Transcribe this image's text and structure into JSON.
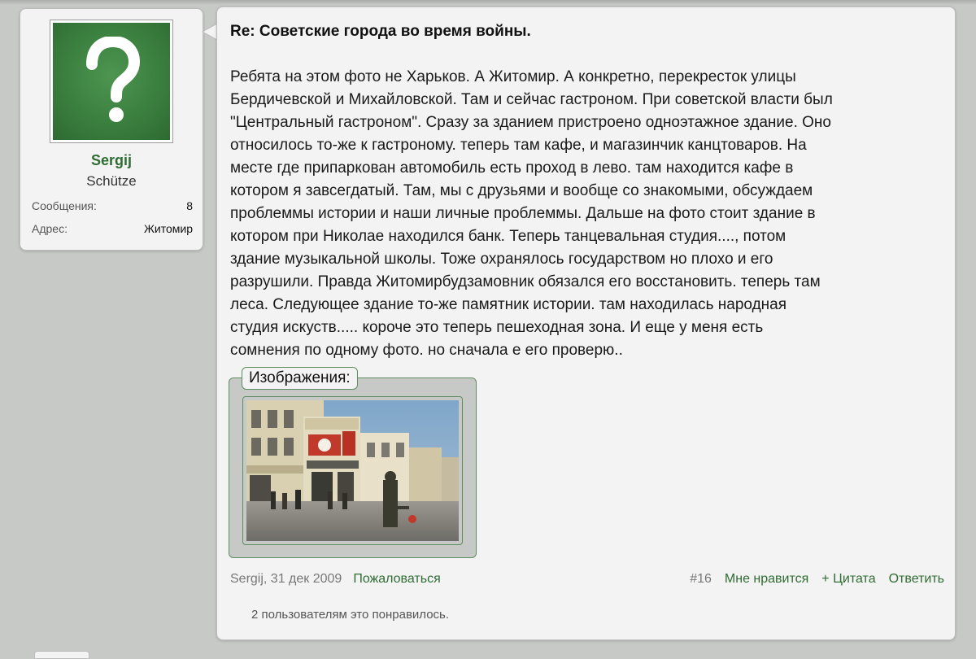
{
  "user": {
    "name": "Sergij",
    "title": "Schütze",
    "stats": [
      {
        "label": "Сообщения:",
        "value": "8"
      },
      {
        "label": "Адрес:",
        "value": "Житомир"
      }
    ],
    "avatar_icon": "question-mark-icon",
    "avatar_color": "#3b7f3f"
  },
  "post": {
    "title": "Re: Советские города во время войны.",
    "body_lines": [
      "Ребята на этом фото не Харьков. А Житомир. А конкретно, перекресток улицы",
      "Бердичевской и Михайловской. Там и сейчас гастроном. При советской власти был",
      "\"Центральный гастроном\". Сразу за зданием пристроено одноэтажное здание. Оно",
      "относилось то-же к гастроному. теперь там кафе, и магазинчик канцтоваров. На",
      "месте где припаркован автомобиль есть проход в лево. там находится кафе в",
      "котором я завсегдатый. Там, мы с друзьями и вообще со знакомыми, обсуждаем",
      "проблеммы истории и наши личные проблеммы. Дальше на фото стоит здание в",
      "котором при Николае находился банк. Теперь танцевальная студия...., потом",
      "здание музыкальной школы. Тоже охранялось государством но плохо и его",
      "разрушили. Правда Житомирбудзамовник обязался его восстановить. теперь там",
      "леса. Следующее здание то-же памятник истории. там находилась народная",
      "студия искуств..... короче это теперь пешеходная зона. И еще у меня есть",
      "сомнения по одному фото. но сначала е его проверю.."
    ],
    "attachments_label": "Изображения:",
    "footer": {
      "author": "Sergij",
      "date": "31 дек 2009",
      "report_label": "Пожаловаться",
      "post_number": "#16",
      "like_label": "Мне нравится",
      "quote_label": "+ Цитата",
      "reply_label": "Ответить"
    },
    "likes_text": "2 пользователям это понравилось."
  },
  "colors": {
    "background": "#c7c9c7",
    "card": "#f3f3f3",
    "accent_green": "#2f6c34",
    "meta_gray": "#777777"
  }
}
